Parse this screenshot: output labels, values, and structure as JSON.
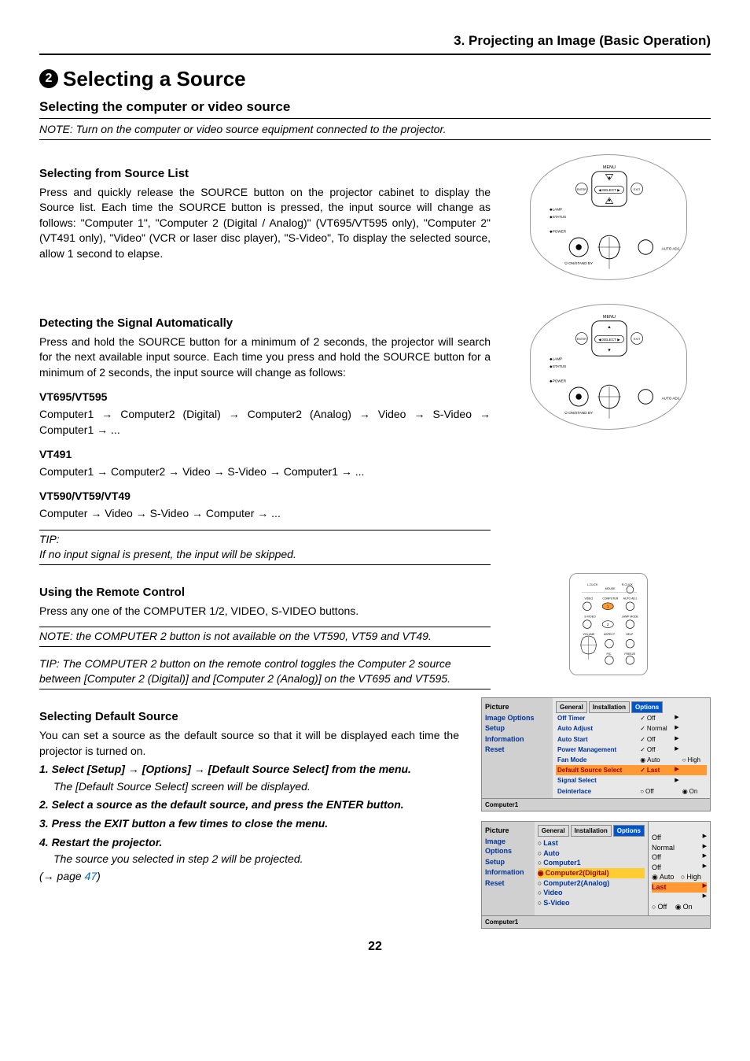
{
  "header": {
    "chapterTitle": "3. Projecting an Image (Basic Operation)"
  },
  "title": {
    "number": "2",
    "text": "Selecting a Source"
  },
  "s1": {
    "heading": "Selecting the computer or video source",
    "note": "NOTE: Turn on the computer or video source equipment connected to the projector."
  },
  "s2": {
    "heading": "Selecting from Source List",
    "body": "Press and quickly release the SOURCE button on the projector cabinet to display the Source list. Each time the SOURCE button is pressed, the input source will change as follows: \"Computer 1\", \"Computer 2 (Digital / Analog)\" (VT695/VT595 only), \"Computer 2\" (VT491 only), \"Video\" (VCR or laser disc player), \"S-Video\", To display the selected source,  allow 1 second to elapse."
  },
  "s3": {
    "heading": "Detecting the Signal Automatically",
    "body": "Press and hold the SOURCE button for a minimum of 2 seconds, the projector will search for the next available input source. Each time you press and hold the SOURCE button for a minimum of 2 seconds, the input source will change as follows:"
  },
  "models": {
    "m1": {
      "name": "VT695/VT595",
      "seq": "Computer1 → Computer2 (Digital) → Computer2 (Analog) → Video → S-Video →  Computer1 → ..."
    },
    "m2": {
      "name": "VT491",
      "seq": "Computer1 → Computer2 → Video → S-Video →  Computer1 → ..."
    },
    "m3": {
      "name": "VT590/VT59/VT49",
      "seq": "Computer → Video → S-Video →  Computer → ..."
    }
  },
  "tip1": {
    "label": "TIP:",
    "text": "If no input signal is present, the input will be skipped."
  },
  "s4": {
    "heading": "Using the Remote Control",
    "body": "Press any one of the COMPUTER 1/2, VIDEO, S-VIDEO buttons.",
    "note": "NOTE: the COMPUTER 2 button is not available on the VT590, VT59 and VT49.",
    "tip": "TIP: The COMPUTER 2 button on the remote control toggles the Computer 2 source between [Computer 2 (Digital)] and [Computer 2 (Analog)] on the VT695 and VT595."
  },
  "s5": {
    "heading": "Selecting Default Source",
    "intro": "You can set a source as the default source so that it will be displayed each time the projector is turned on.",
    "steps": {
      "s1": "1.  Select [Setup] → [Options] → [Default Source Select] from the menu.",
      "s1d": "The [Default Source Select] screen will be displayed.",
      "s2": "2.  Select a source as the default source, and press the ENTER button.",
      "s3": "3.  Press the EXIT button a few times to close the menu.",
      "s4": "4.  Restart the projector.",
      "s4d": "The source you selected in step 2 will be projected."
    },
    "ref": "(→ page ",
    "refnum": "47",
    "refend": ")"
  },
  "pageNumber": "22",
  "panelLabels": {
    "menu": "MENU",
    "select": "SELECT",
    "lamp": "LAMP",
    "status": "STATUS",
    "power": "POWER",
    "onstandby": "ON/STAND BY",
    "autoadj": "AUTO ADJ.",
    "enter": "ENTER",
    "exit": "EXIT"
  },
  "remoteLabels": {
    "lclick": "L-CLICK",
    "rclick": "R-CLICK",
    "mouse": "MOUSE",
    "video": "VIDEO",
    "computer": "COMPUTER",
    "autoadj": "AUTO ADJ.",
    "svideo": "S-VIDEO",
    "lampmode": "LAMP MODE",
    "volume": "VOLUME",
    "aspect": "ASPECT",
    "help": "HELP",
    "pic": "PIC.",
    "freeze": "FREEZE",
    "n1": "1",
    "n2": "2"
  },
  "menu1": {
    "nav": {
      "picture": "Picture",
      "imageOptions": "Image Options",
      "setup": "Setup",
      "information": "Information",
      "reset": "Reset"
    },
    "tabs": {
      "general": "General",
      "installation": "Installation",
      "options": "Options"
    },
    "rows": {
      "offTimer": "Off Timer",
      "offTimerV": "Off",
      "autoAdjust": "Auto Adjust",
      "autoAdjustV": "Normal",
      "autoStart": "Auto Start",
      "autoStartV": "Off",
      "powerMgmt": "Power Management",
      "powerMgmtV": "Off",
      "fanMode": "Fan Mode",
      "fanModeA": "Auto",
      "fanModeH": "High",
      "defSrc": "Default Source Select",
      "defSrcV": "Last",
      "sigSel": "Signal Select",
      "deint": "Deinterlace",
      "deintOff": "Off",
      "deintOn": "On"
    },
    "footer": "Computer1"
  },
  "menu2": {
    "opts": {
      "last": "Last",
      "auto": "Auto",
      "c1": "Computer1",
      "c2d": "Computer2(Digital)",
      "c2a": "Computer2(Analog)",
      "video": "Video",
      "svideo": "S-Video"
    },
    "rcol": {
      "off1": "Off",
      "normal": "Normal",
      "off2": "Off",
      "off3": "Off",
      "auto": "Auto",
      "high": "High",
      "last": "Last",
      "off4": "Off",
      "on": "On"
    }
  }
}
